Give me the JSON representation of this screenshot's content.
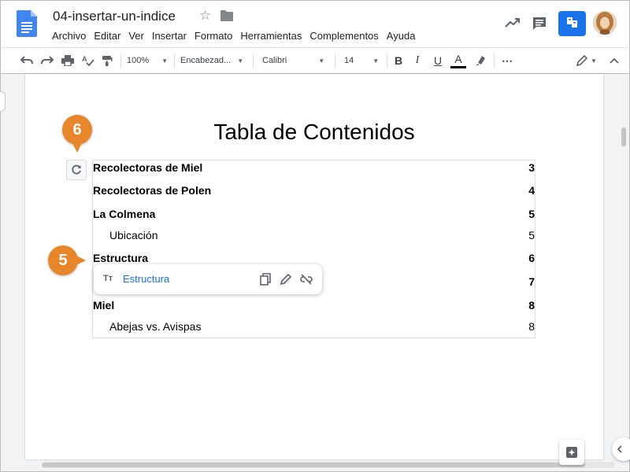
{
  "app": {
    "doc_title": "04-insertar-un-indice",
    "menu": [
      "Archivo",
      "Editar",
      "Ver",
      "Insertar",
      "Formato",
      "Herramientas",
      "Complementos",
      "Ayuda"
    ],
    "accent_color": "#1a73e8",
    "brand_color": "#4285f4"
  },
  "toolbar": {
    "zoom": "100%",
    "style": "Encabezad...",
    "font": "Calibri",
    "font_size": "14",
    "bold": "B",
    "italic": "I",
    "underline": "U",
    "text_color": "A",
    "more": "⋯"
  },
  "document": {
    "toc_title": "Tabla de Contenidos",
    "toc_entries": [
      {
        "label": "Recolectoras de Miel",
        "page": "3",
        "level": 1
      },
      {
        "label": "Recolectoras de Polen",
        "page": "4",
        "level": 1
      },
      {
        "label": "La Colmena",
        "page": "5",
        "level": 1
      },
      {
        "label": "Ubicación",
        "page": "5",
        "level": 2
      },
      {
        "label": "Estructura",
        "page": "6",
        "level": 1
      },
      {
        "label": "",
        "page": "7",
        "level": 1
      },
      {
        "label": "Miel",
        "page": "8",
        "level": 1
      },
      {
        "label": "Abejas vs. Avispas",
        "page": "8",
        "level": 2
      }
    ]
  },
  "link_popup": {
    "type_icon": "Tт",
    "link_text": "Estructura"
  },
  "badges": {
    "step_refresh": "6",
    "step_link": "5"
  }
}
